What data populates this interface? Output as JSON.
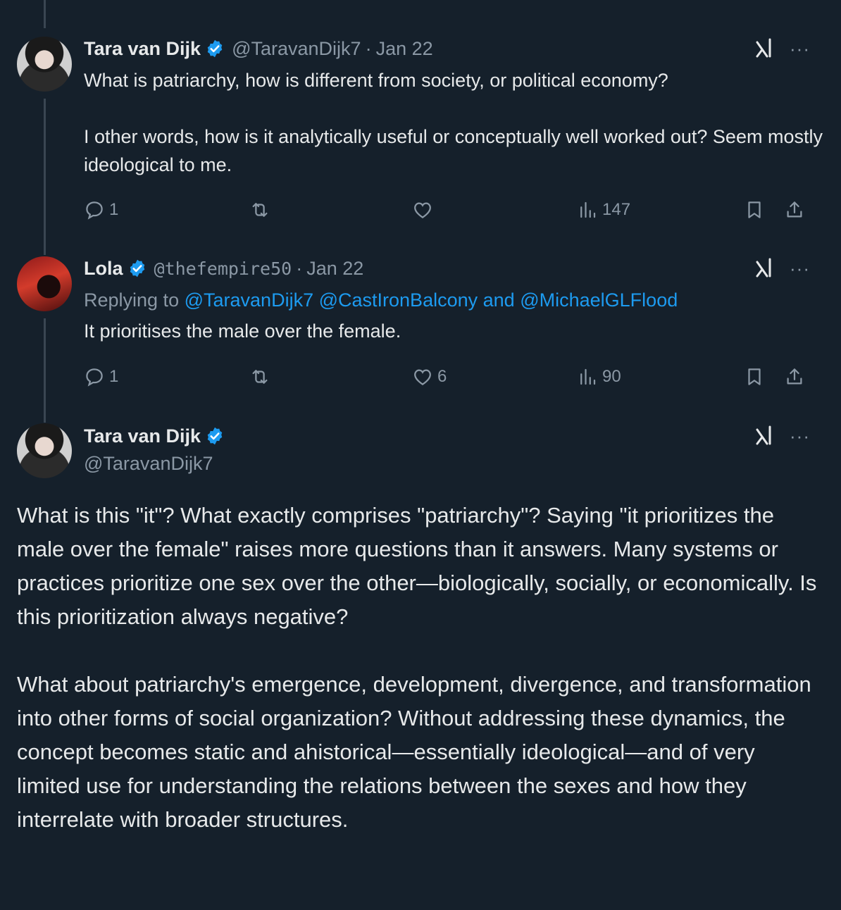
{
  "tweet1": {
    "name": "Tara van Dijk",
    "handle": "@TaravanDijk7",
    "date": "Jan 22",
    "text": "What is patriarchy, how is different from society, or political economy?\n\nI other words, how is it analytically useful or conceptually well worked out? Seem mostly ideological to me.",
    "replies": "1",
    "retweets": "",
    "likes": "",
    "views": "147"
  },
  "tweet2": {
    "name": "Lola",
    "handle": "@thefempire50",
    "date": "Jan 22",
    "replying_label": "Replying to",
    "mention1": "@TaravanDijk7",
    "mention2": "@CastIronBalcony",
    "and_label": "and",
    "mention3": "@MichaelGLFlood",
    "text": "It prioritises the male over the female.",
    "replies": "1",
    "retweets": "",
    "likes": "6",
    "views": "90"
  },
  "tweet3": {
    "name": "Tara van Dijk",
    "handle": "@TaravanDijk7",
    "paragraph1": "What is this \"it\"? What exactly comprises \"patriarchy\"? Saying \"it prioritizes the male over the female\" raises more questions than it answers. Many systems or practices prioritize one sex over the other—biologically, socially, or economically. Is this prioritization always negative?",
    "paragraph2": "What about patriarchy's emergence, development, divergence, and transformation into other forms of social organization? Without addressing these dynamics, the concept becomes static and ahistorical—essentially ideological—and of very limited use for understanding the relations between the sexes and how they interrelate with broader structures."
  },
  "icons": {
    "verified": "verified-badge-icon",
    "grok": "grok-icon",
    "more": "more-icon",
    "reply": "reply-icon",
    "retweet": "retweet-icon",
    "like": "like-icon",
    "views": "views-icon",
    "bookmark": "bookmark-icon",
    "share": "share-icon"
  },
  "colors": {
    "background": "#15202b",
    "text": "#e7e9ea",
    "secondary": "#8b98a5",
    "accent": "#1d9bf0"
  }
}
